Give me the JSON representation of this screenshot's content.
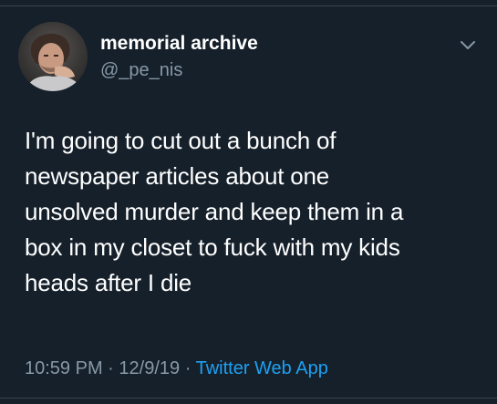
{
  "tweet": {
    "author": {
      "display_name": "memorial archive",
      "handle": "@_pe_nis"
    },
    "text": "I'm going to cut out a bunch of\nnewspaper articles about one\nunsolved murder and keep them in a\nbox in my closet to fuck with my kids\nheads after I die",
    "time": "10:59 PM",
    "separator": "·",
    "date": "12/9/19",
    "source": "Twitter Web App"
  },
  "icons": {
    "more": "chevron-down-icon",
    "avatar": "profile-photo"
  },
  "colors": {
    "background": "#15202b",
    "primary_text": "#ffffff",
    "secondary_text": "#8899a6",
    "link": "#1da1f2",
    "divider": "#38444d"
  }
}
